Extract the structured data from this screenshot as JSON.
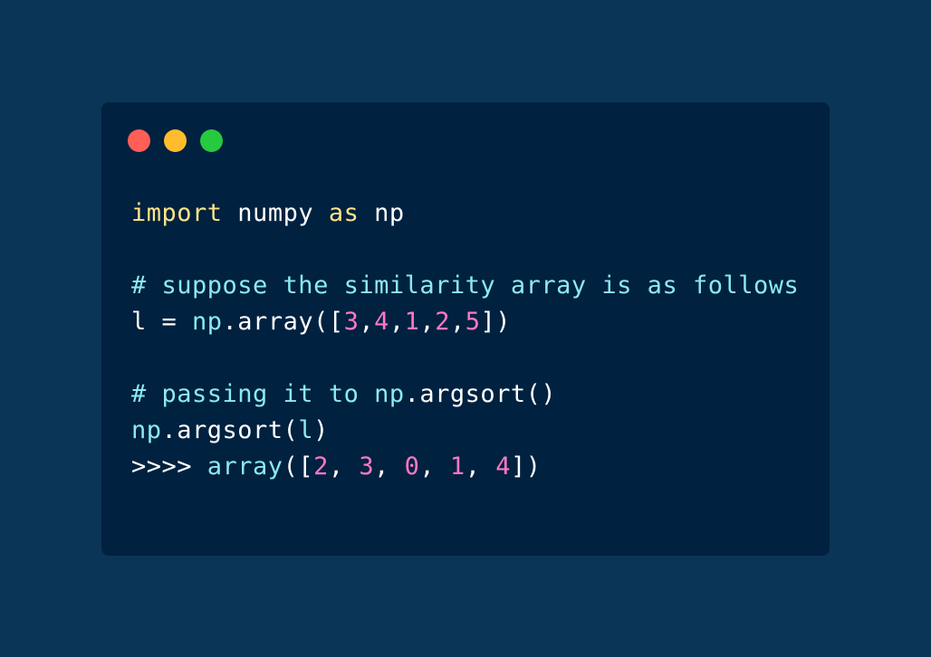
{
  "window": {
    "controls": [
      {
        "name": "close-dot",
        "color": "#ff5f56"
      },
      {
        "name": "minimize-dot",
        "color": "#ffbd2e"
      },
      {
        "name": "maximize-dot",
        "color": "#27c93f"
      }
    ]
  },
  "colors": {
    "keyword": "#fde488",
    "plain": "#ffffff",
    "cyan": "#8beaf1",
    "number": "#ff79c6"
  },
  "code": {
    "lines": [
      [
        {
          "text": "import",
          "kind": "keyword"
        },
        {
          "text": " numpy ",
          "kind": "plain"
        },
        {
          "text": "as",
          "kind": "keyword"
        },
        {
          "text": " np",
          "kind": "plain"
        }
      ],
      [],
      [
        {
          "text": "# suppose the similarity array is as follows",
          "kind": "cyan"
        }
      ],
      [
        {
          "text": "l = ",
          "kind": "plain"
        },
        {
          "text": "np",
          "kind": "cyan"
        },
        {
          "text": ".array([",
          "kind": "plain"
        },
        {
          "text": "3",
          "kind": "number"
        },
        {
          "text": ",",
          "kind": "plain"
        },
        {
          "text": "4",
          "kind": "number"
        },
        {
          "text": ",",
          "kind": "plain"
        },
        {
          "text": "1",
          "kind": "number"
        },
        {
          "text": ",",
          "kind": "plain"
        },
        {
          "text": "2",
          "kind": "number"
        },
        {
          "text": ",",
          "kind": "plain"
        },
        {
          "text": "5",
          "kind": "number"
        },
        {
          "text": "])",
          "kind": "plain"
        }
      ],
      [],
      [
        {
          "text": "# passing it to ",
          "kind": "cyan"
        },
        {
          "text": "np",
          "kind": "cyan"
        },
        {
          "text": ".argsort()",
          "kind": "plain"
        }
      ],
      [
        {
          "text": "np",
          "kind": "cyan"
        },
        {
          "text": ".argsort(",
          "kind": "plain"
        },
        {
          "text": "l",
          "kind": "cyan"
        },
        {
          "text": ")",
          "kind": "plain"
        }
      ],
      [
        {
          "text": ">>>> ",
          "kind": "plain"
        },
        {
          "text": "array",
          "kind": "cyan"
        },
        {
          "text": "([",
          "kind": "plain"
        },
        {
          "text": "2",
          "kind": "number"
        },
        {
          "text": ", ",
          "kind": "plain"
        },
        {
          "text": "3",
          "kind": "number"
        },
        {
          "text": ", ",
          "kind": "plain"
        },
        {
          "text": "0",
          "kind": "number"
        },
        {
          "text": ", ",
          "kind": "plain"
        },
        {
          "text": "1",
          "kind": "number"
        },
        {
          "text": ", ",
          "kind": "plain"
        },
        {
          "text": "4",
          "kind": "number"
        },
        {
          "text": "])",
          "kind": "plain"
        }
      ]
    ]
  }
}
